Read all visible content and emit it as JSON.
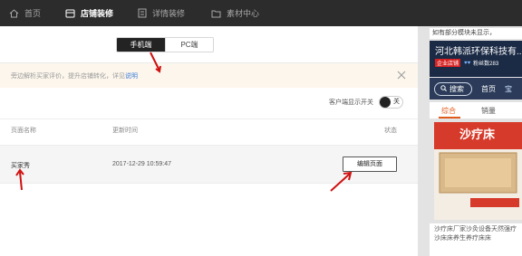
{
  "nav": {
    "items": [
      {
        "label": "首页",
        "icon": "home-icon",
        "active": false
      },
      {
        "label": "店铺装修",
        "icon": "store-icon",
        "active": true
      },
      {
        "label": "详情装修",
        "icon": "detail-page-icon",
        "active": false
      },
      {
        "label": "素材中心",
        "icon": "folder-icon",
        "active": false
      }
    ]
  },
  "device_tabs": [
    {
      "label": "手机端",
      "active": true
    },
    {
      "label": "PC端",
      "active": false
    }
  ],
  "notice": {
    "text": "旁边解析买家评价，提升店铺转化，详见",
    "link_label": "说明"
  },
  "toggle": {
    "label": "客户端显示开关",
    "state_label": "关",
    "on": false
  },
  "table": {
    "headers": {
      "name": "页面名称",
      "updated": "更新时间",
      "status": "状态"
    },
    "rows": [
      {
        "name": "买家秀",
        "updated": "2017-12-29 10:59:47",
        "action_label": "编辑页面"
      }
    ]
  },
  "preview": {
    "topbar": "如有部分模块未显示，",
    "shop_name": "河北韩派环保科技有...",
    "badge": "企业店铺",
    "fans": "粉丝数283",
    "search_label": "搜索",
    "home_label": "首页",
    "more_label": "宝",
    "tabs": [
      {
        "label": "综合",
        "active": true
      },
      {
        "label": "销量",
        "active": false
      }
    ],
    "product_title": "沙疗床",
    "product_desc": "沙疗床厂家沙灸设备天然强疗沙床床养生养疗床床",
    "colors": {
      "accent": "#e05a1a",
      "shop_bg": "#1b2a45",
      "nav_bg": "#2b3b59"
    }
  },
  "colors": {
    "topnav_bg": "#2c2c2c",
    "notice_bg": "#fcf6ec",
    "arrow": "#d01010"
  }
}
